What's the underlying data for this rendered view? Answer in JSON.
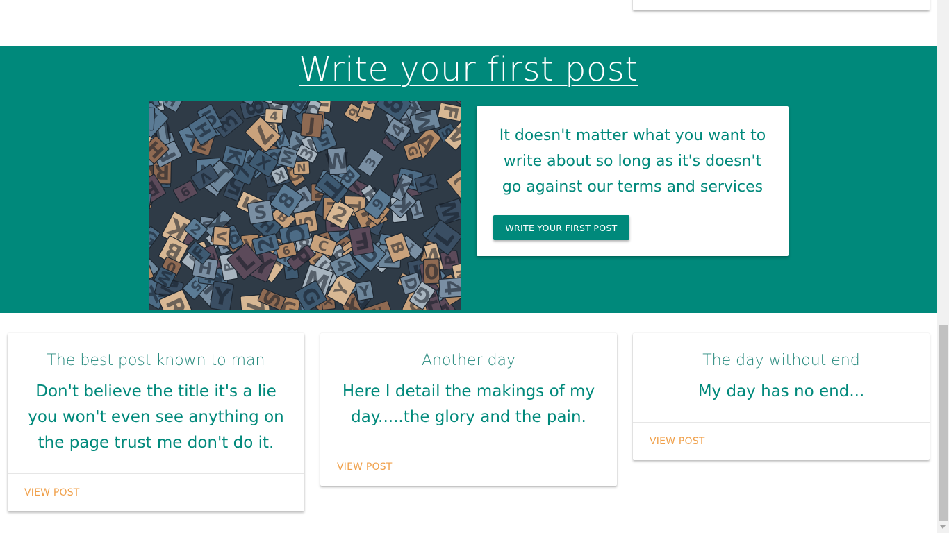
{
  "hero": {
    "title": "Write your first post",
    "image_alt": "Pile of wooden letterpress type blocks",
    "card_text": "It doesn't matter what you want to write about so long as it's doesn't go against our terms and services",
    "button_label": "WRITE YOUR FIRST POST",
    "background_color": "#00897b"
  },
  "posts": [
    {
      "title": "The best post known to man",
      "body": "Don't believe the title it's a lie you won't even see anything on the page trust me don't do it.",
      "action_label": "VIEW POST"
    },
    {
      "title": "Another day",
      "body": "Here I detail the makings of my day.....the glory and the pain.",
      "action_label": "VIEW POST"
    },
    {
      "title": "The day without end",
      "body": "My day has no end...",
      "action_label": "VIEW POST"
    }
  ],
  "colors": {
    "accent": "#00897b",
    "link": "#f0a04a"
  }
}
